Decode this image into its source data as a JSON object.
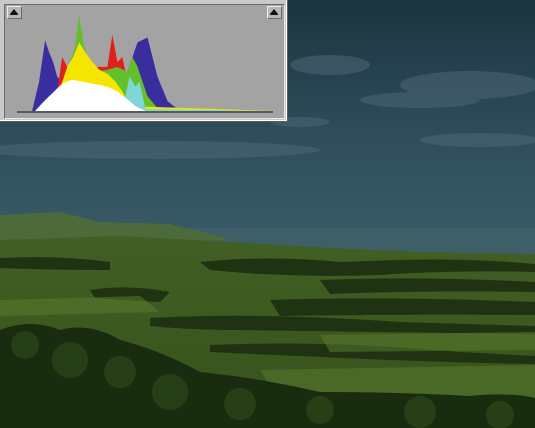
{
  "panel": {
    "title": "",
    "clip_shadows_icon": "triangle-up-icon",
    "clip_highlights_icon": "triangle-up-icon"
  },
  "colors": {
    "panel_bg": "#c9c9c9",
    "plot_bg": "#a3a3a3",
    "red": "#e0211a",
    "green": "#63c02b",
    "blue": "#3a2e9e",
    "yellow": "#f4e600",
    "cyan": "#7fd6d6",
    "magenta": "#8a2fb0",
    "white": "#ffffff",
    "sky": "#2d4b59",
    "land": "#3b5a1e"
  },
  "chart_data": {
    "type": "area",
    "title": "",
    "xlabel": "",
    "ylabel": "",
    "xlim": [
      0,
      255
    ],
    "ylim": [
      0,
      1
    ],
    "grid": false,
    "series": [
      {
        "color_key": "blue",
        "x": [
          0,
          15,
          22,
          28,
          32,
          36,
          40,
          45,
          50,
          60,
          70,
          80,
          90,
          100,
          110,
          120,
          130,
          140,
          150,
          160,
          170,
          180,
          190,
          200,
          210,
          255
        ],
        "y": [
          0,
          0.0,
          0.3,
          0.72,
          0.6,
          0.5,
          0.35,
          0.3,
          0.28,
          0.34,
          0.38,
          0.36,
          0.3,
          0.28,
          0.4,
          0.7,
          0.75,
          0.35,
          0.1,
          0.02,
          0,
          0,
          0,
          0,
          0,
          0
        ]
      },
      {
        "color_key": "red",
        "x": [
          0,
          30,
          40,
          45,
          50,
          55,
          60,
          70,
          80,
          90,
          95,
          100,
          105,
          110,
          118,
          125,
          135,
          145,
          255
        ],
        "y": [
          0,
          0,
          0.2,
          0.55,
          0.45,
          0.3,
          0.25,
          0.3,
          0.45,
          0.45,
          0.78,
          0.5,
          0.55,
          0.3,
          0.2,
          0.1,
          0.02,
          0,
          0
        ]
      },
      {
        "color_key": "green",
        "x": [
          0,
          30,
          40,
          50,
          58,
          62,
          66,
          70,
          80,
          90,
          100,
          110,
          115,
          120,
          130,
          140,
          150,
          255
        ],
        "y": [
          0,
          0,
          0.15,
          0.4,
          0.65,
          0.98,
          0.7,
          0.55,
          0.4,
          0.42,
          0.45,
          0.4,
          0.55,
          0.45,
          0.15,
          0.03,
          0,
          0
        ]
      },
      {
        "color_key": "yellow",
        "x": [
          0,
          35,
          42,
          50,
          56,
          62,
          68,
          75,
          82,
          90,
          98,
          105,
          112,
          255
        ],
        "y": [
          0,
          0,
          0.2,
          0.45,
          0.55,
          0.7,
          0.6,
          0.5,
          0.42,
          0.38,
          0.3,
          0.2,
          0.05,
          0
        ]
      },
      {
        "color_key": "cyan",
        "x": [
          0,
          100,
          108,
          112,
          118,
          122,
          128,
          255
        ],
        "y": [
          0,
          0,
          0.15,
          0.35,
          0.25,
          0.3,
          0.02,
          0
        ]
      },
      {
        "color_key": "white",
        "x": [
          0,
          18,
          25,
          35,
          45,
          55,
          65,
          75,
          85,
          92,
          100,
          110,
          118,
          128,
          255
        ],
        "y": [
          0,
          0,
          0.08,
          0.18,
          0.28,
          0.32,
          0.3,
          0.28,
          0.26,
          0.24,
          0.2,
          0.12,
          0.05,
          0,
          0
        ]
      }
    ]
  }
}
